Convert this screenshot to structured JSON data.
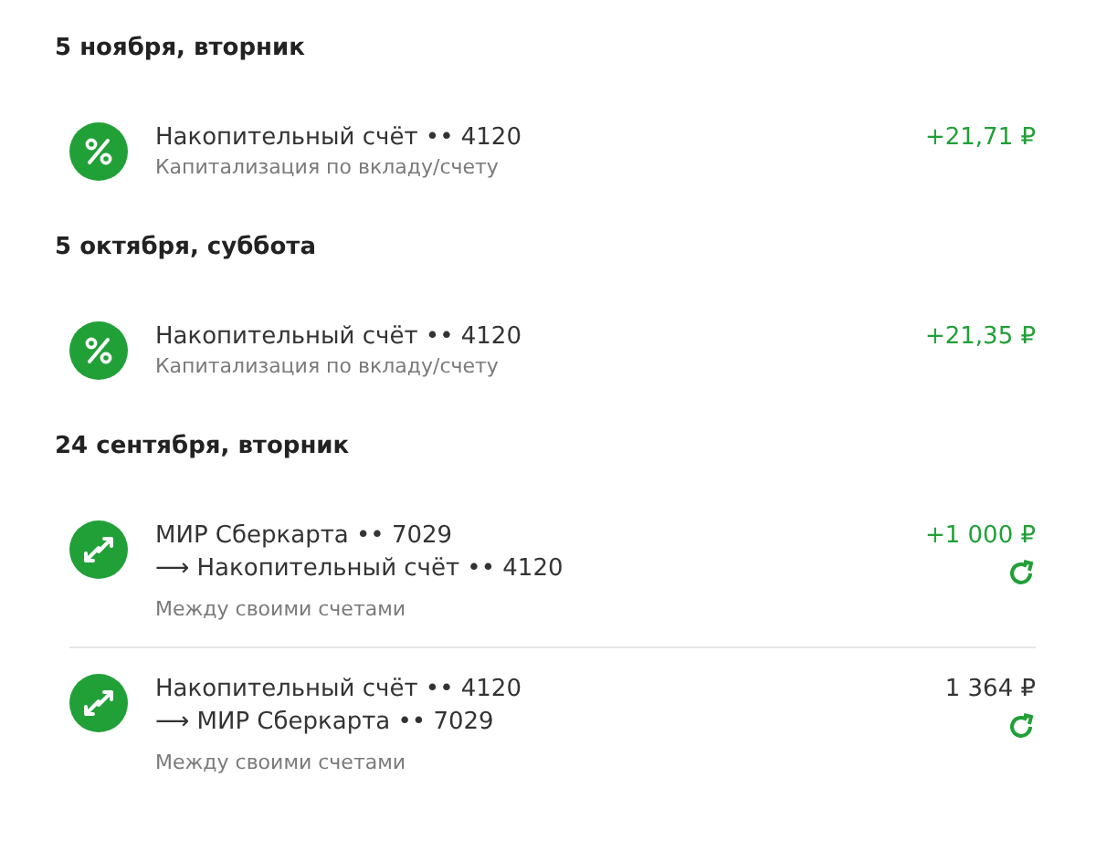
{
  "groups": [
    {
      "date": "5 ноября, вторник",
      "transactions": [
        {
          "kind": "interest",
          "title": "Накопительный счёт •• 4120",
          "subtitle": "Капитализация по вкладу/счету",
          "amount": "+21,71 ₽",
          "incoming": true,
          "repeat": false
        }
      ]
    },
    {
      "date": "5 октября, суббота",
      "transactions": [
        {
          "kind": "interest",
          "title": "Накопительный счёт •• 4120",
          "subtitle": "Капитализация по вкладу/счету",
          "amount": "+21,35 ₽",
          "incoming": true,
          "repeat": false
        }
      ]
    },
    {
      "date": "24 сентября, вторник",
      "transactions": [
        {
          "kind": "transfer",
          "title": "МИР Сберкарта •• 7029",
          "to": "⟶ Накопительный счёт •• 4120",
          "subtitle": "Между своими счетами",
          "amount": "+1 000 ₽",
          "incoming": true,
          "repeat": true
        },
        {
          "kind": "transfer",
          "title": "Накопительный счёт •• 4120",
          "to": "⟶ МИР Сберкарта •• 7029",
          "subtitle": "Между своими счетами",
          "amount": "1 364 ₽",
          "incoming": false,
          "repeat": true
        }
      ]
    }
  ]
}
